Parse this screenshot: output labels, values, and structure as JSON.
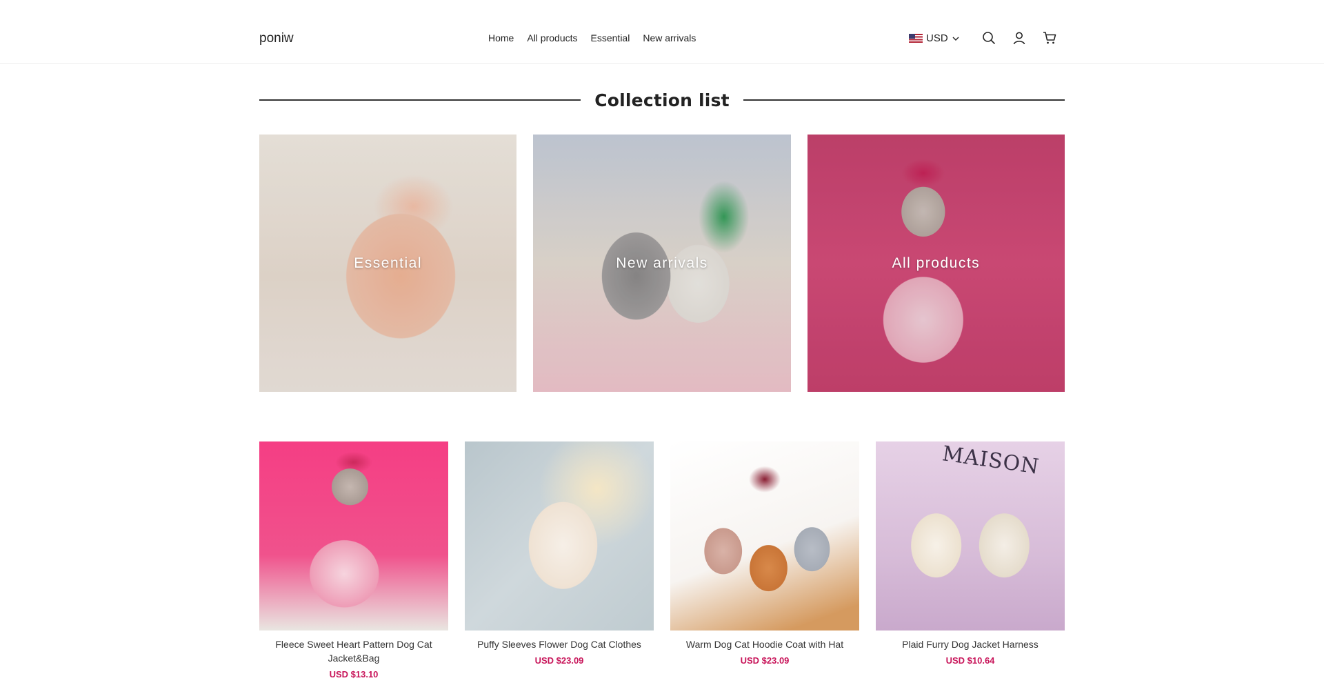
{
  "header": {
    "logo": "poniw",
    "nav": [
      "Home",
      "All products",
      "Essential",
      "New arrivals"
    ],
    "currency": "USD",
    "icons": [
      "search-icon",
      "account-icon",
      "cart-icon"
    ]
  },
  "collection_section": {
    "title": "Collection list",
    "items": [
      {
        "label": "Essential"
      },
      {
        "label": "New arrivals"
      },
      {
        "label": "All products"
      }
    ]
  },
  "products": [
    {
      "title": "Fleece Sweet Heart Pattern Dog Cat Jacket&Bag",
      "price": "USD $13.10"
    },
    {
      "title": "Puffy Sleeves Flower Dog Cat Clothes",
      "price": "USD $23.09"
    },
    {
      "title": "Warm Dog Cat Hoodie Coat with Hat",
      "price": "USD $23.09"
    },
    {
      "title": "Plaid Furry Dog Jacket Harness",
      "price": "USD $10.64"
    }
  ],
  "image_text": {
    "p4_backdrop": "MAISON"
  },
  "colors": {
    "price": "#c8155a",
    "text": "#222222",
    "border": "#ececec"
  }
}
